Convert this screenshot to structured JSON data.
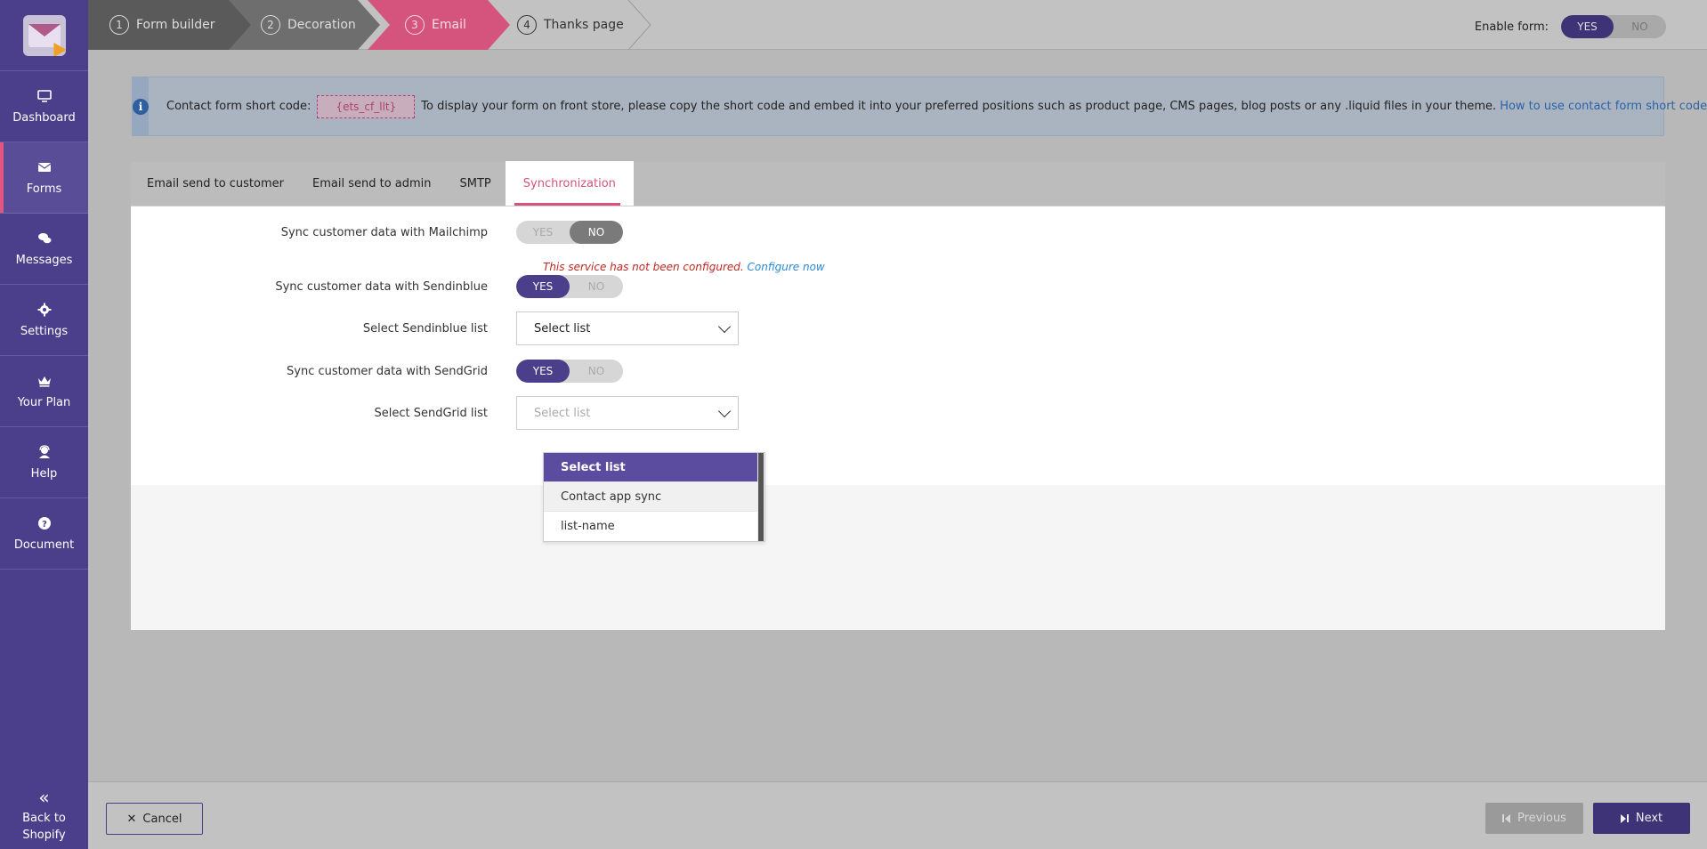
{
  "sidebar": {
    "items": [
      {
        "label": "Dashboard",
        "icon": "monitor-icon"
      },
      {
        "label": "Forms",
        "icon": "envelope-icon"
      },
      {
        "label": "Messages",
        "icon": "chat-icon"
      },
      {
        "label": "Settings",
        "icon": "gear-icon"
      },
      {
        "label": "Your Plan",
        "icon": "crown-icon"
      },
      {
        "label": "Help",
        "icon": "support-icon"
      },
      {
        "label": "Document",
        "icon": "question-circle-icon"
      }
    ],
    "back_line1": "Back to",
    "back_line2": "Shopify"
  },
  "steps": [
    {
      "num": "1",
      "label": "Form builder"
    },
    {
      "num": "2",
      "label": "Decoration"
    },
    {
      "num": "3",
      "label": "Email"
    },
    {
      "num": "4",
      "label": "Thanks page"
    }
  ],
  "enable_form": {
    "label": "Enable form:",
    "yes": "YES",
    "no": "NO"
  },
  "info": {
    "prefix": "Contact form short code:",
    "code": "{ets_cf_llt}",
    "text": "To display your form on front store, please copy the short code and embed it into your preferred positions such as product page, CMS pages, blog posts or any .liquid files in your theme.",
    "link": "How to use contact form short code?"
  },
  "tabs": [
    "Email send to customer",
    "Email send to admin",
    "SMTP",
    "Synchronization"
  ],
  "sync": {
    "mailchimp_label": "Sync customer data with Mailchimp",
    "error_text": "This service has not been configured.",
    "configure_link": "Configure now",
    "sendinblue_label": "Sync customer data with Sendinblue",
    "sendinblue_list_label": "Select Sendinblue list",
    "sendinblue_list_value": "Select list",
    "sendgrid_label": "Sync customer data with SendGrid",
    "sendgrid_list_label": "Select SendGrid list",
    "sendgrid_list_placeholder": "Select list",
    "yes": "YES",
    "no": "NO"
  },
  "dropdown_options": [
    "Select list",
    "Contact app sync",
    "list-name"
  ],
  "footer": {
    "cancel": "Cancel",
    "previous": "Previous",
    "next": "Next"
  },
  "colors": {
    "primary": "#4b3e8a",
    "accent": "#d4547e",
    "link": "#2a8ad8",
    "error": "#c0271f"
  }
}
